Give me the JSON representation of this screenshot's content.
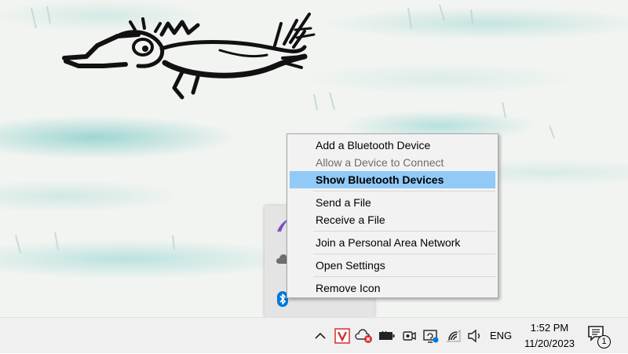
{
  "context_menu": {
    "items": [
      {
        "label": "Add a Bluetooth Device",
        "state": "normal"
      },
      {
        "label": "Allow a Device to Connect",
        "state": "disabled"
      },
      {
        "label": "Show Bluetooth Devices",
        "state": "highlighted"
      },
      {
        "label": "Send a File",
        "state": "normal"
      },
      {
        "label": "Receive a File",
        "state": "normal"
      },
      {
        "label": "Join a Personal Area Network",
        "state": "normal"
      },
      {
        "label": "Open Settings",
        "state": "normal"
      },
      {
        "label": "Remove Icon",
        "state": "normal"
      }
    ]
  },
  "tray_overflow": {
    "icons": [
      "feather-app-icon",
      "cloud-icon",
      "bluetooth-icon"
    ]
  },
  "taskbar": {
    "tray_icons": [
      "chevron-up-icon",
      "v-app-icon",
      "cloud-error-icon",
      "battery-icon",
      "video-camera-icon",
      "screen-update-icon",
      "wifi-icon",
      "speaker-icon"
    ],
    "language": "ENG",
    "time": "1:52 PM",
    "date": "11/20/2023",
    "notification_count": "1"
  },
  "colors": {
    "menu_highlight": "#91c9f7",
    "menu_background": "#f2f2f2",
    "taskbar_background": "#f0f0f0",
    "bluetooth_blue": "#0078d7",
    "error_red": "#d62f2f"
  }
}
